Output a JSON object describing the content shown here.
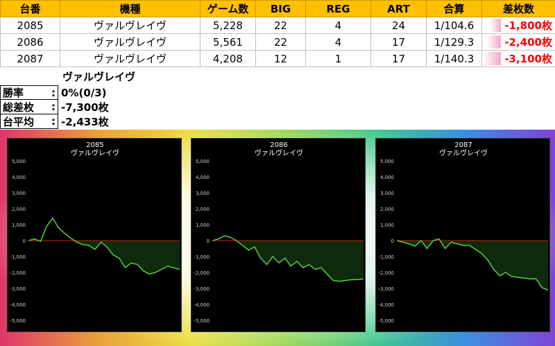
{
  "table": {
    "headers": [
      "台番",
      "機種",
      "ゲーム数",
      "BIG",
      "REG",
      "ART",
      "合算",
      "差枚数"
    ],
    "rows": [
      {
        "unit": "2085",
        "model": "ヴァルヴレイヴ",
        "games": "5,228",
        "big": "22",
        "reg": "4",
        "art": "24",
        "combined": "1/104.6",
        "diff": "-1,800枚",
        "diff_level": 0.58
      },
      {
        "unit": "2086",
        "model": "ヴァルヴレイヴ",
        "games": "5,561",
        "big": "22",
        "reg": "4",
        "art": "17",
        "combined": "1/129.3",
        "diff": "-2,400枚",
        "diff_level": 0.77
      },
      {
        "unit": "2087",
        "model": "ヴァルヴレイヴ",
        "games": "4,208",
        "big": "12",
        "reg": "1",
        "art": "17",
        "combined": "1/140.3",
        "diff": "-3,100枚",
        "diff_level": 1.0
      }
    ]
  },
  "summary": {
    "model": "ヴァルヴレイヴ",
    "rows": [
      {
        "label": "勝率",
        "colon": ":",
        "value": "0%(0/3)"
      },
      {
        "label": "総差枚",
        "colon": ":",
        "value": "-7,300枚"
      },
      {
        "label": "台平均",
        "colon": ":",
        "value": "-2,433枚"
      }
    ]
  },
  "colors": {
    "header_bg": "#ffc000",
    "negative_text": "#ff0000",
    "line": "#55c244",
    "zero_line": "#cc2200",
    "negative_fill": "#0d2a0d"
  },
  "chart_data": [
    {
      "type": "line",
      "title": "2085",
      "subtitle": "ヴァルヴレイヴ",
      "ylim": [
        -5000,
        5000
      ],
      "yticks": [
        "5,000",
        "4,000",
        "3,000",
        "2,000",
        "1,000",
        "0",
        "-1,000",
        "-2,000",
        "-3,000",
        "-4,000",
        "-5,000"
      ],
      "x": [
        0,
        1,
        2,
        3,
        4,
        5,
        6,
        7,
        8,
        9,
        10,
        11,
        12,
        13,
        14,
        15,
        16,
        17,
        18,
        19,
        20,
        21,
        22,
        23,
        24,
        25
      ],
      "values": [
        0,
        100,
        -50,
        900,
        1400,
        800,
        450,
        150,
        -100,
        -250,
        -300,
        -550,
        -100,
        -400,
        -900,
        -1100,
        -1700,
        -1400,
        -1500,
        -1900,
        -2100,
        -2000,
        -1800,
        -1600,
        -1700,
        -1800
      ]
    },
    {
      "type": "line",
      "title": "2086",
      "subtitle": "ヴァルヴレイヴ",
      "ylim": [
        -5000,
        5000
      ],
      "yticks": [
        "5,000",
        "4,000",
        "3,000",
        "2,000",
        "1,000",
        "0",
        "-1,000",
        "-2,000",
        "-3,000",
        "-4,000",
        "-5,000"
      ],
      "x": [
        0,
        1,
        2,
        3,
        4,
        5,
        6,
        7,
        8,
        9,
        10,
        11,
        12,
        13,
        14,
        15,
        16,
        17,
        18,
        19,
        20,
        21,
        22,
        23,
        24,
        25
      ],
      "values": [
        0,
        100,
        300,
        200,
        0,
        -300,
        -600,
        -400,
        -1100,
        -1500,
        -1000,
        -1400,
        -1100,
        -1600,
        -1300,
        -1700,
        -1500,
        -1800,
        -1700,
        -2100,
        -2500,
        -2550,
        -2500,
        -2450,
        -2450,
        -2400
      ]
    },
    {
      "type": "line",
      "title": "2087",
      "subtitle": "ヴァルヴレイヴ",
      "ylim": [
        -5000,
        5000
      ],
      "yticks": [
        "5,000",
        "4,000",
        "3,000",
        "2,000",
        "1,000",
        "0",
        "-1,000",
        "-2,000",
        "-3,000",
        "-4,000",
        "-5,000"
      ],
      "x": [
        0,
        1,
        2,
        3,
        4,
        5,
        6,
        7,
        8,
        9,
        10,
        11,
        12,
        13,
        14,
        15,
        16,
        17,
        18,
        19,
        20,
        21,
        22,
        23,
        24,
        25
      ],
      "values": [
        0,
        -100,
        -200,
        -350,
        0,
        -500,
        0,
        100,
        -500,
        -100,
        -200,
        -300,
        -300,
        -550,
        -800,
        -1200,
        -1800,
        -2200,
        -2000,
        -2250,
        -2300,
        -2350,
        -2400,
        -2400,
        -2950,
        -3100
      ]
    }
  ]
}
